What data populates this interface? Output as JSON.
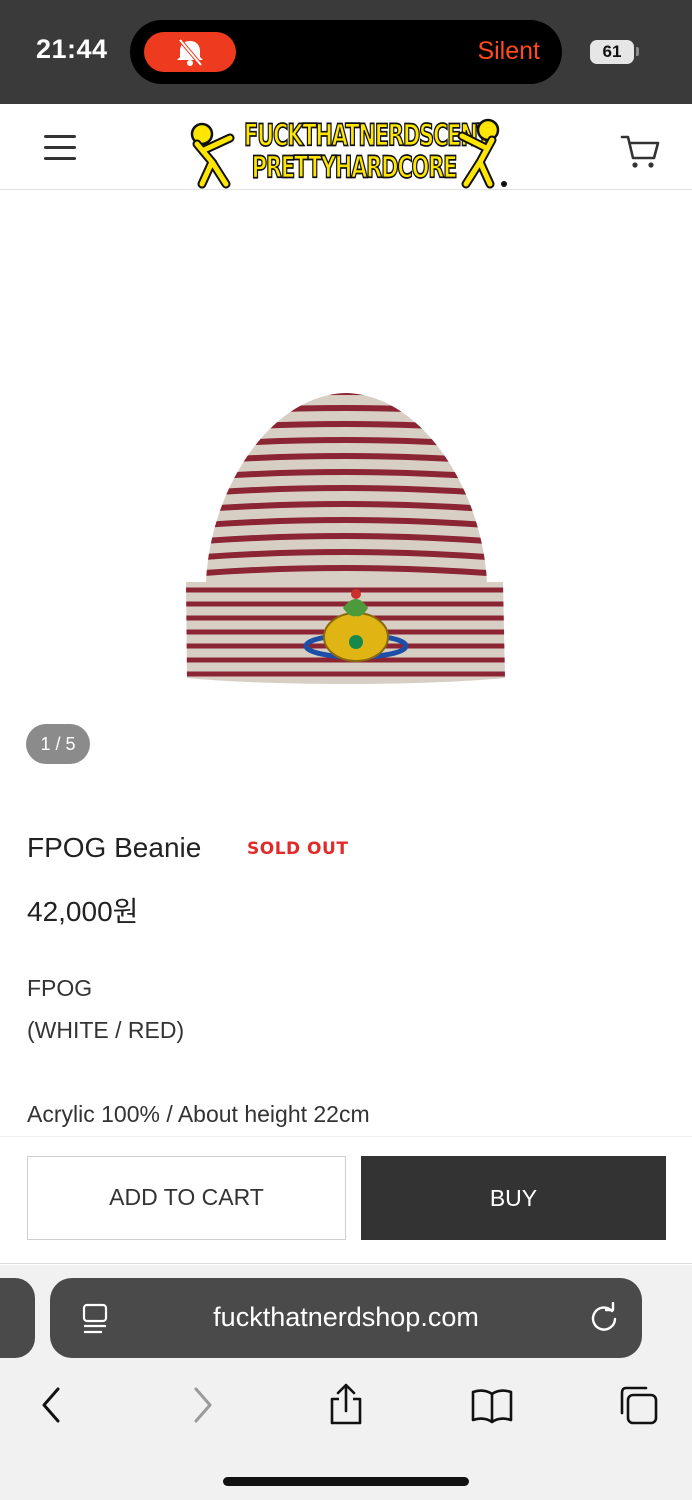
{
  "status_bar": {
    "time": "21:44",
    "silent_label": "Silent",
    "battery_level": "61",
    "silent_pill_color": "#ee3b1f"
  },
  "header": {
    "logo_line1": "FUCKTHATNERDSCENT",
    "logo_line2": "PRETTYHARDCORE",
    "logo_color": "#ffe600",
    "menu_icon": "hamburger-menu-icon",
    "cart_icon": "cart-icon"
  },
  "gallery": {
    "counter": "1 / 5",
    "image_alt": "striped white and red beanie with orb embroidery"
  },
  "product": {
    "name": "FPOG Beanie",
    "badge": "SOLD OUT",
    "badge_color": "#e02b2b",
    "price": "42,000원",
    "description": [
      "FPOG",
      "(WHITE / RED)",
      "Acrylic 100% / About height 22cm"
    ]
  },
  "actions": {
    "add_to_cart_label": "ADD TO CART",
    "buy_label": "BUY",
    "buy_color": "#333333"
  },
  "browser": {
    "url": "fuckthatnerdshop.com",
    "toolbar_icons": [
      "back-icon",
      "forward-icon",
      "share-icon",
      "bookmarks-icon",
      "tabs-icon"
    ]
  }
}
